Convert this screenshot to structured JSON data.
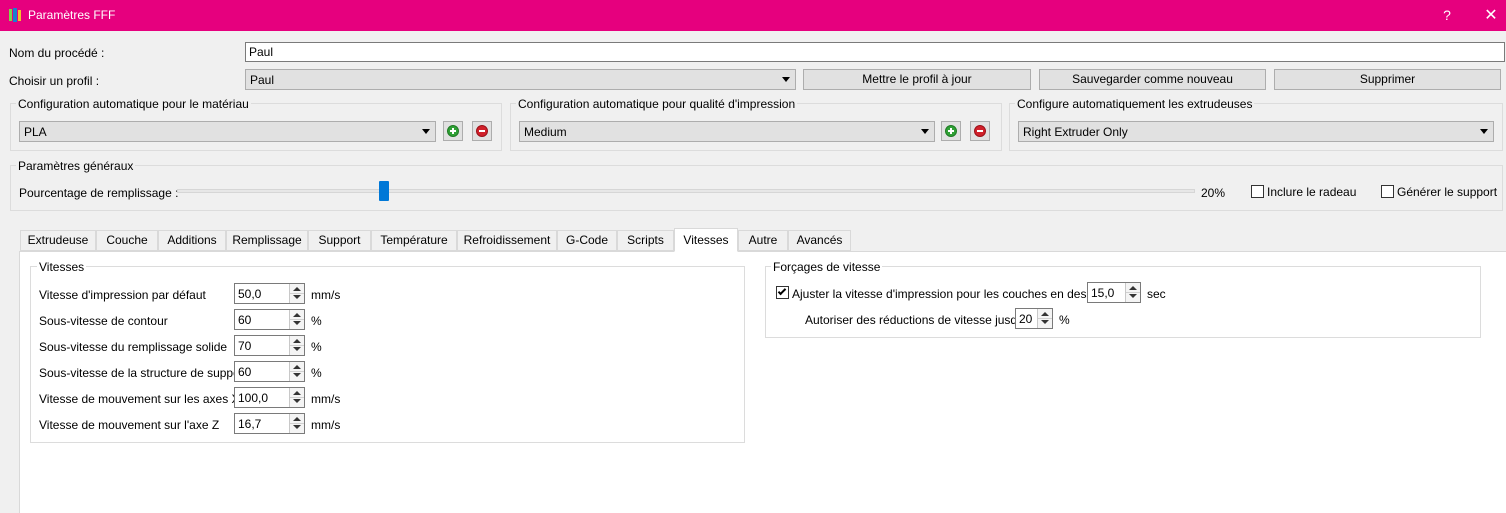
{
  "window": {
    "title": "Paramètres FFF",
    "help_label": "?",
    "close_label": "✕",
    "title_bar_color": "#e6007e"
  },
  "process": {
    "name_label": "Nom du procédé :",
    "name_value": "Paul",
    "profile_label": "Choisir un profil :",
    "profile_value": "Paul",
    "update_button": "Mettre le profil à jour",
    "save_new_button": "Sauvegarder comme nouveau",
    "delete_button": "Supprimer"
  },
  "auto_config": {
    "material": {
      "title": "Configuration automatique pour le matériau",
      "value": "PLA"
    },
    "quality": {
      "title": "Configuration automatique pour qualité d'impression",
      "value": "Medium"
    },
    "extruders": {
      "title": "Configure automatiquement les extrudeuses",
      "value": "Right Extruder Only"
    }
  },
  "general": {
    "title": "Paramètres généraux",
    "infill_label": "Pourcentage de remplissage :",
    "infill_value_text": "20%",
    "infill_percent": 20,
    "raft_label": "Inclure le radeau",
    "raft_checked": false,
    "support_label": "Générer le support",
    "support_checked": false
  },
  "tabs": [
    {
      "label": "Extrudeuse",
      "active": false
    },
    {
      "label": "Couche",
      "active": false
    },
    {
      "label": "Additions",
      "active": false
    },
    {
      "label": "Remplissage",
      "active": false
    },
    {
      "label": "Support",
      "active": false
    },
    {
      "label": "Température",
      "active": false
    },
    {
      "label": "Refroidissement",
      "active": false
    },
    {
      "label": "G-Code",
      "active": false
    },
    {
      "label": "Scripts",
      "active": false
    },
    {
      "label": "Vitesses",
      "active": true
    },
    {
      "label": "Autre",
      "active": false
    },
    {
      "label": "Avancés",
      "active": false
    }
  ],
  "speeds": {
    "title": "Vitesses",
    "rows": [
      {
        "label": "Vitesse d'impression par défaut",
        "value": "50,0",
        "unit": "mm/s"
      },
      {
        "label": "Sous-vitesse de contour",
        "value": "60",
        "unit": "%"
      },
      {
        "label": "Sous-vitesse du remplissage solide",
        "value": "70",
        "unit": "%"
      },
      {
        "label": "Sous-vitesse de la structure de support",
        "value": "60",
        "unit": "%"
      },
      {
        "label": "Vitesse de mouvement sur les axes X/Y",
        "value": "100,0",
        "unit": "mm/s"
      },
      {
        "label": "Vitesse de mouvement sur l'axe Z",
        "value": "16,7",
        "unit": "mm/s"
      }
    ]
  },
  "overrides": {
    "title": "Forçages de vitesse",
    "adjust_label": "Ajuster la vitesse d'impression pour les couches en dessous",
    "adjust_checked": true,
    "adjust_value": "15,0",
    "adjust_unit": "sec",
    "reduction_label": "Autoriser des réductions de vitesse jusqu'à",
    "reduction_value": "20",
    "reduction_unit": "%"
  }
}
